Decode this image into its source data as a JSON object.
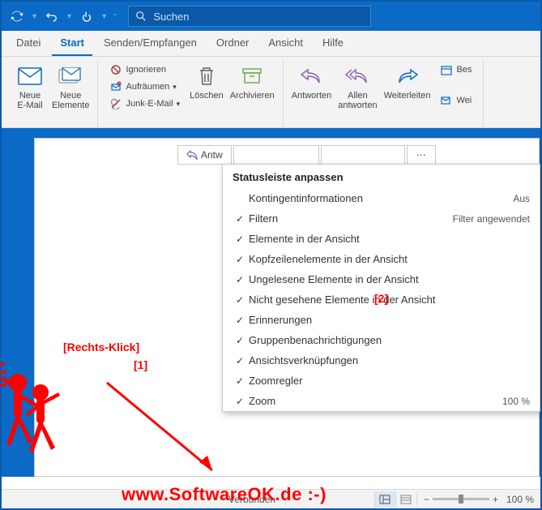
{
  "search": {
    "placeholder": "Suchen"
  },
  "tabs": {
    "file": "Datei",
    "start": "Start",
    "sendrecv": "Senden/Empfangen",
    "folder": "Ordner",
    "view": "Ansicht",
    "help": "Hilfe"
  },
  "ribbon": {
    "newmail": "Neue\nE-Mail",
    "newitems": "Neue\nElemente",
    "ignore": "Ignorieren",
    "cleanup": "Aufräumen",
    "junk": "Junk-E-Mail",
    "delete": "Löschen",
    "archive": "Archivieren",
    "reply": "Antworten",
    "replyall": "Allen\nantworten",
    "forward": "Weiterleiten",
    "meeting": "Bes",
    "more": "Wei"
  },
  "pane": {
    "reply": "Antw"
  },
  "context": {
    "title": "Statusleiste anpassen",
    "items": [
      {
        "check": false,
        "label": "Kontingentinformationen",
        "right": "Aus"
      },
      {
        "check": true,
        "label": "Filtern",
        "right": "Filter angewendet"
      },
      {
        "check": true,
        "label": "Elemente in der Ansicht",
        "right": ""
      },
      {
        "check": true,
        "label": "Kopfzeilenelemente in der Ansicht",
        "right": ""
      },
      {
        "check": true,
        "label": "Ungelesene Elemente in der Ansicht",
        "right": ""
      },
      {
        "check": true,
        "label": "Nicht gesehene Elemente in der Ansicht",
        "right": ""
      },
      {
        "check": true,
        "label": "Erinnerungen",
        "right": ""
      },
      {
        "check": true,
        "label": "Gruppenbenachrichtigungen",
        "right": ""
      },
      {
        "check": true,
        "label": "Ansichtsverknüpfungen",
        "right": ""
      },
      {
        "check": true,
        "label": "Zoomregler",
        "right": ""
      },
      {
        "check": true,
        "label": "Zoom",
        "right": "100 %"
      }
    ]
  },
  "status": {
    "connected": "Verbunden",
    "zoom": "100 %"
  },
  "anno": {
    "rc": "[Rechts-Klick]",
    "n1": "[1]",
    "n2": "[2]"
  },
  "wm": "www.SoftwareOK.de :-)"
}
